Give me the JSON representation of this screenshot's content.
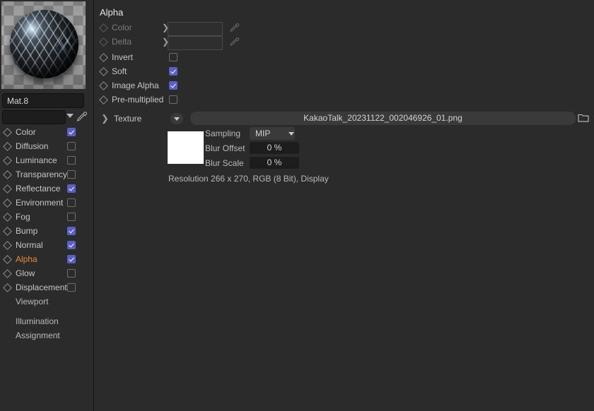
{
  "theme": {
    "panel_bg": "#2b2b2b",
    "field_bg": "#1d1d1d",
    "accent_checked": "#5b5fc7",
    "active_channel": "#e8893c",
    "text": "#c6c6c6",
    "text_dim": "#7b7b7b"
  },
  "sidebar": {
    "preview_name": "material-preview-sphere",
    "material_name": "Mat.8",
    "material_select_value": "",
    "channels": [
      {
        "label": "Color",
        "checked": true,
        "active": false
      },
      {
        "label": "Diffusion",
        "checked": false,
        "active": false
      },
      {
        "label": "Luminance",
        "checked": false,
        "active": false
      },
      {
        "label": "Transparency",
        "checked": false,
        "active": false
      },
      {
        "label": "Reflectance",
        "checked": true,
        "active": false
      },
      {
        "label": "Environment",
        "checked": false,
        "active": false
      },
      {
        "label": "Fog",
        "checked": false,
        "active": false
      },
      {
        "label": "Bump",
        "checked": true,
        "active": false
      },
      {
        "label": "Normal",
        "checked": true,
        "active": false
      },
      {
        "label": "Alpha",
        "checked": true,
        "active": true
      },
      {
        "label": "Glow",
        "checked": false,
        "active": false
      },
      {
        "label": "Displacement",
        "checked": false,
        "active": false
      }
    ],
    "sub_items": [
      {
        "label": "Viewport"
      },
      {
        "label": "Illumination"
      },
      {
        "label": "Assignment"
      }
    ]
  },
  "panel": {
    "title": "Alpha",
    "rows": [
      {
        "label": "Color",
        "type": "color",
        "disabled": true,
        "value": ""
      },
      {
        "label": "Delta",
        "type": "color",
        "disabled": true,
        "value": ""
      },
      {
        "label": "Invert",
        "type": "checkbox",
        "checked": false
      },
      {
        "label": "Soft",
        "type": "checkbox",
        "checked": true
      },
      {
        "label": "Image Alpha",
        "type": "checkbox",
        "checked": true
      },
      {
        "label": "Pre-multiplied",
        "type": "checkbox",
        "checked": false
      }
    ],
    "texture": {
      "label": "Texture",
      "filename": "KakaoTalk_20231122_002046926_01.png",
      "sampling_label": "Sampling",
      "sampling_value": "MIP",
      "blur_offset_label": "Blur Offset",
      "blur_offset_value": "0 %",
      "blur_scale_label": "Blur Scale",
      "blur_scale_value": "0 %",
      "resolution_info": "Resolution 266 x 270, RGB (8 Bit), Display"
    }
  }
}
